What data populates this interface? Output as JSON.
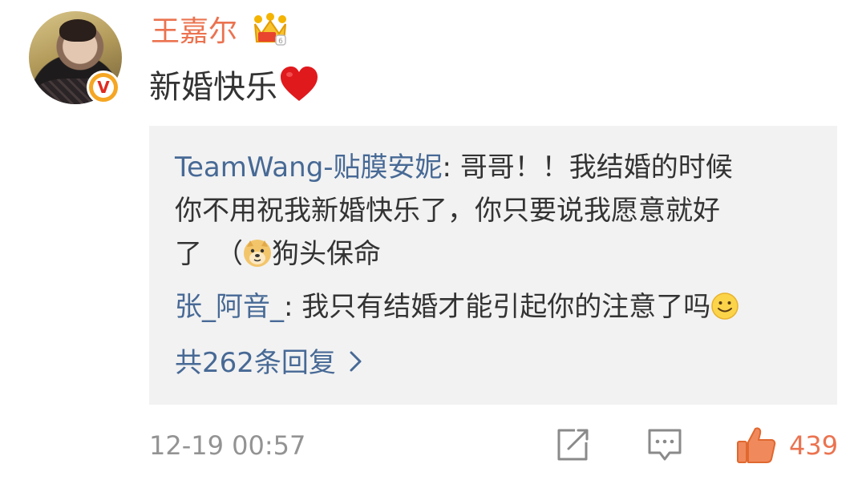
{
  "comment": {
    "username": "王嘉尔",
    "text": "新婚快乐",
    "timestamp": "12-19 00:57",
    "like_count": "439",
    "badges": {
      "verified": "V",
      "member_crown_icon": "crown-icon",
      "heart_emoji": "red-heart-icon"
    }
  },
  "replies": [
    {
      "author": "TeamWang-贴膜安妮",
      "separator": ": ",
      "line1": "哥哥！！我结婚的时候",
      "line2": "你不用祝我新婚快乐了，你只要说我愿意就好",
      "line3_pre": "了　（",
      "emoji": "doge-icon",
      "line3_post": "狗头保命"
    },
    {
      "author": "张_阿音_",
      "separator": ": ",
      "text": "我只有结婚才能引起你的注意了吗",
      "emoji": "smile-icon"
    }
  ],
  "more_replies_label": "共262条回复",
  "colors": {
    "username": "#eb7350",
    "reply_author": "#476995",
    "reply_bg": "#f2f2f2",
    "meta": "#939393",
    "like": "#eb7350"
  }
}
